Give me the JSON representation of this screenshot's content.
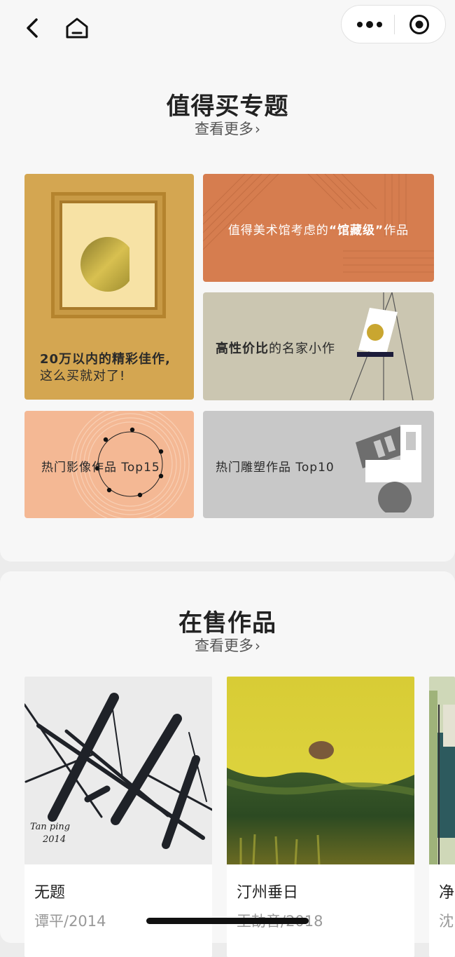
{
  "nav": {
    "back_icon": "chevron-left-icon",
    "home_icon": "home-icon",
    "more_icon": "more-dots-icon",
    "target_icon": "record-target-icon"
  },
  "section_topics": {
    "title": "值得买专题",
    "more": "查看更多",
    "cards": {
      "under200k": {
        "line1": "20万以内的精彩佳作,",
        "line2": "这么买就对了!"
      },
      "museum": {
        "pre": "值得美术馆考虑的",
        "open_quote": "“",
        "highlight": "馆藏级",
        "close_quote": "”",
        "post": "作品"
      },
      "value": {
        "highlight": "高性价比",
        "rest": "的名家小作"
      },
      "photo": {
        "label": "热门影像作品 Top15"
      },
      "sculpture": {
        "label": "热门雕塑作品 Top10"
      }
    }
  },
  "section_sale": {
    "title": "在售作品",
    "more": "查看更多",
    "items": [
      {
        "title": "无题",
        "artist_year": "谭平/2014"
      },
      {
        "title": "汀州垂日",
        "artist_year": "王劼音/2018"
      },
      {
        "title": "净",
        "artist_year": "沈"
      }
    ],
    "signature": {
      "line1": "Tan ping",
      "line2": "2014"
    }
  },
  "colors": {
    "gold": "#d4a651",
    "orange": "#d67d4f",
    "beige": "#cbc6b1",
    "peach": "#f4b894",
    "grey": "#c8c8c8",
    "painting_yellow": "#d8cf3a"
  }
}
